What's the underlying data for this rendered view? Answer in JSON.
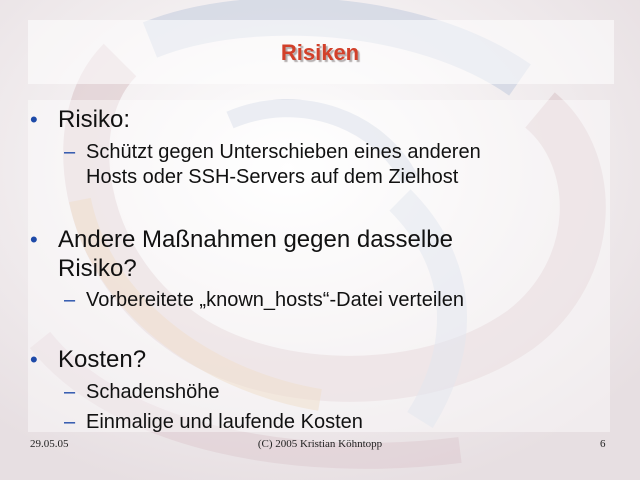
{
  "slide": {
    "title": "Risiken",
    "bullets": [
      {
        "lines": [
          "Risiko:"
        ],
        "subs": [
          {
            "lines": [
              "Schützt gegen Unterschieben eines anderen",
              "Hosts oder SSH-Servers auf dem Zielhost"
            ]
          }
        ]
      },
      {
        "lines": [
          "Andere Maßnahmen gegen dasselbe",
          "Risiko?"
        ],
        "subs": [
          {
            "lines": [
              "Vorbereitete „known_hosts“-Datei verteilen"
            ]
          }
        ]
      },
      {
        "lines": [
          "Kosten?"
        ],
        "subs": [
          {
            "lines": [
              "Schadenshöhe"
            ]
          },
          {
            "lines": [
              "Einmalige und laufende Kosten"
            ]
          }
        ]
      }
    ],
    "bullet_glyph": "•",
    "dash_glyph": "–"
  },
  "footer": {
    "date": "29.05.05",
    "copyright": "(C) 2005 Kristian Köhntopp",
    "page_number": "6"
  },
  "colors": {
    "title": "#d2402a",
    "bullet": "#1e4aa8",
    "text": "#111111"
  }
}
